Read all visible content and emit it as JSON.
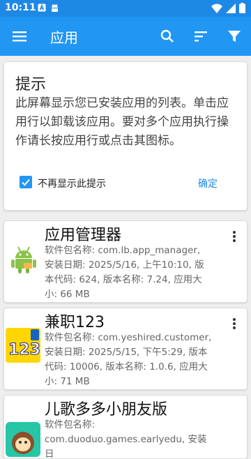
{
  "status_bar": {
    "time": "10:11",
    "icons_left": [
      "a-box-icon",
      "android-icon"
    ],
    "icons_right": [
      "wifi-icon",
      "signal-icon",
      "battery-icon"
    ]
  },
  "app_bar": {
    "title": "应用",
    "actions": [
      "search-icon",
      "sort-icon",
      "filter-icon"
    ]
  },
  "tip": {
    "title": "提示",
    "body": "此屏幕显示您已安装应用的列表。单击应用行以卸载该应用。要对多个应用执行操作请长按应用行或点击其图标。",
    "checkbox_label": "不再显示此提示",
    "checkbox_checked": true,
    "ok_label": "确定"
  },
  "apps": [
    {
      "name": "应用管理器",
      "info": "软件包名称: com.lb.app_manager, 安装日期: 2025/5/16, 上午10:10, 版本代码: 624, 版本名称: 7.24, 应用大小: 66 MB",
      "icon": "android-robot-icon"
    },
    {
      "name": "兼职123",
      "info": "软件包名称: com.yeshired.customer, 安装日期: 2025/5/15, 下午5:29, 版本代码: 10006, 版本名称: 1.0.6, 应用大小: 71 MB",
      "icon": "jianzhi123-icon"
    },
    {
      "name": "儿歌多多小朋友版",
      "info": "软件包名称: com.duoduo.games.earlyedu, 安装日",
      "icon": "monkey-icon"
    }
  ],
  "colors": {
    "primary": "#2196f3",
    "status_bar": "#1e88e5",
    "background": "#eeeeee"
  }
}
